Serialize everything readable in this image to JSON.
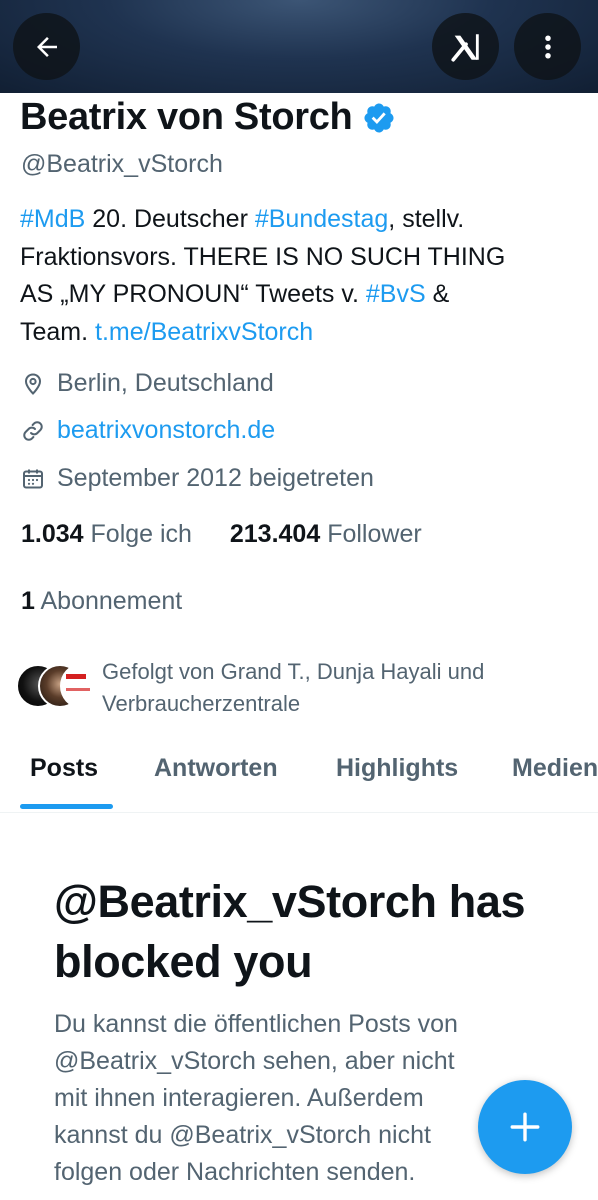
{
  "header": {
    "back_icon": "arrow-left-icon",
    "grok_icon": "grok-icon",
    "more_icon": "more-vertical-icon"
  },
  "profile": {
    "display_name": "Beatrix von Storch",
    "verified_icon": "verified-badge-icon",
    "verified_color": "#1d9bf0",
    "handle": "@Beatrix_vStorch",
    "bio": {
      "l1_tag1": "#MdB",
      "l1_text1": " 20. Deutscher ",
      "l1_tag2": "#Bundestag",
      "l1_text2": ", stellv.",
      "l2": "Fraktionsvors. THERE IS NO SUCH THING",
      "l3_text1": "AS „MY PRONOUN“ Tweets v. ",
      "l3_tag": "#BvS",
      "l3_text2": " &",
      "l4_text": "Team. ",
      "l4_link": "t.me/BeatrixvStorch"
    },
    "location": "Berlin, Deutschland",
    "website": "beatrixvonstorch.de",
    "joined": "September 2012 beigetreten",
    "following_count": "1.034",
    "following_label": "Folge ich",
    "followers_count": "213.404",
    "followers_label": "Follower",
    "subscriptions_count": "1",
    "subscriptions_label": "Abonnement",
    "followed_by": "Gefolgt von Grand T., Dunja Hayali und Verbraucherzentrale"
  },
  "tabs": [
    {
      "label": "Posts",
      "active": true
    },
    {
      "label": "Antworten",
      "active": false
    },
    {
      "label": "Highlights",
      "active": false
    },
    {
      "label": "Medien",
      "active": false
    }
  ],
  "blocked": {
    "title": "@Beatrix_vStorch has blocked you",
    "body_l1": "Du kannst die öffentlichen Posts von",
    "body_l2": "@Beatrix_vStorch sehen, aber nicht",
    "body_l3": "mit ihnen interagieren. Außerdem",
    "body_l4": "kannst du @Beatrix_vStorch nicht",
    "body_l5": "folgen oder Nachrichten senden."
  },
  "fab": {
    "icon": "plus-icon"
  },
  "colors": {
    "accent": "#1d9bf0",
    "text": "#0f1419",
    "secondary": "#536471"
  }
}
